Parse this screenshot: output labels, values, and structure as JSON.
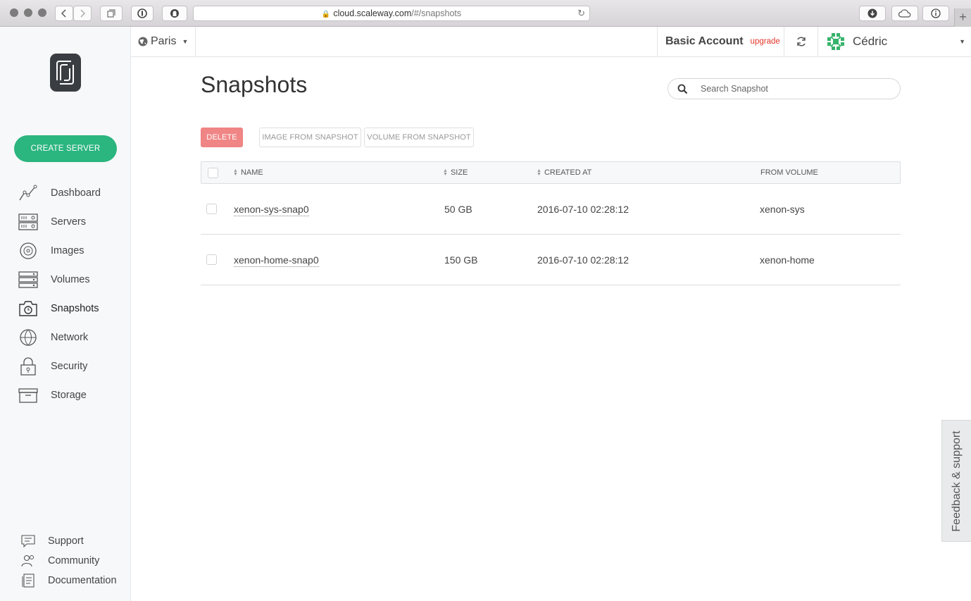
{
  "browser": {
    "url_host": "cloud.scaleway.com",
    "url_path": "/#/snapshots"
  },
  "sidebar": {
    "create_button": "CREATE SERVER",
    "items": [
      {
        "label": "Dashboard",
        "icon": "dashboard-icon"
      },
      {
        "label": "Servers",
        "icon": "servers-icon"
      },
      {
        "label": "Images",
        "icon": "images-icon"
      },
      {
        "label": "Volumes",
        "icon": "volumes-icon"
      },
      {
        "label": "Snapshots",
        "icon": "snapshots-icon",
        "active": true
      },
      {
        "label": "Network",
        "icon": "network-icon"
      },
      {
        "label": "Security",
        "icon": "security-icon"
      },
      {
        "label": "Storage",
        "icon": "storage-icon"
      }
    ],
    "bottom_items": [
      {
        "label": "Support",
        "icon": "support-icon"
      },
      {
        "label": "Community",
        "icon": "community-icon"
      },
      {
        "label": "Documentation",
        "icon": "documentation-icon"
      }
    ]
  },
  "topbar": {
    "region": "Paris",
    "account_name": "Basic Account",
    "upgrade_label": "upgrade",
    "user_name": "Cédric"
  },
  "main": {
    "title": "Snapshots",
    "search_placeholder": "Search Snapshot",
    "actions": {
      "delete": "DELETE",
      "image_from_snapshot": "IMAGE FROM SNAPSHOT",
      "volume_from_snapshot": "VOLUME FROM SNAPSHOT"
    },
    "table": {
      "columns": {
        "name": "NAME",
        "size": "SIZE",
        "created_at": "CREATED AT",
        "from_volume": "FROM VOLUME"
      },
      "rows": [
        {
          "name": "xenon-sys-snap0",
          "size": "50 GB",
          "created_at": "2016-07-10 02:28:12",
          "from_volume": "xenon-sys"
        },
        {
          "name": "xenon-home-snap0",
          "size": "150 GB",
          "created_at": "2016-07-10 02:28:12",
          "from_volume": "xenon-home"
        }
      ]
    }
  },
  "feedback_label": "Feedback & support",
  "colors": {
    "accent": "#2bb57f",
    "danger": "#f08585",
    "upgrade": "#e3362b"
  }
}
